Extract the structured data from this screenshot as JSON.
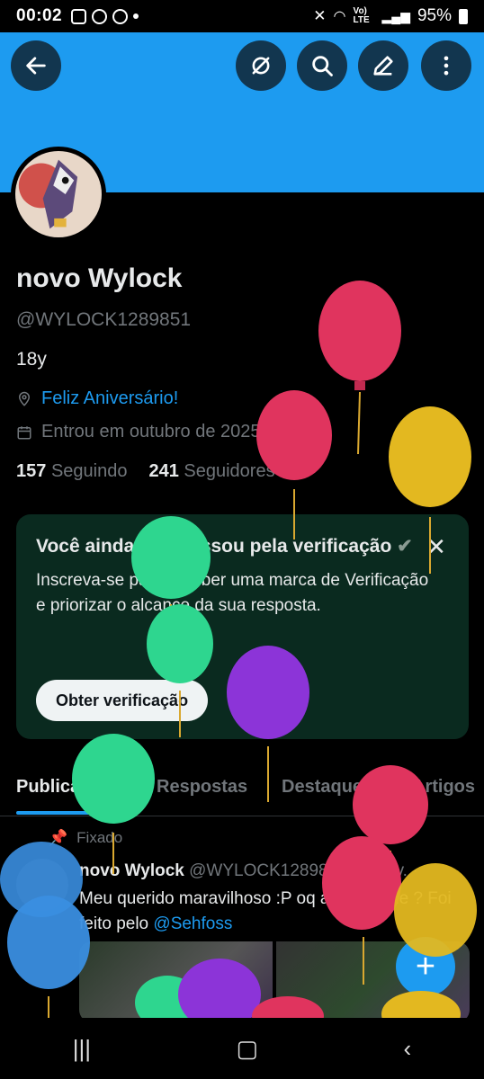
{
  "status_bar": {
    "time": "00:02",
    "network": "Vo) LTE",
    "battery": "95%"
  },
  "profile": {
    "name": "novo Wylock",
    "handle": "@WYLOCK1289851",
    "bio": "18y",
    "birthday_link": "Feliz Aniversário!",
    "joined": "Entrou em outubro de 2025",
    "following_count": "157",
    "following_label": "Seguindo",
    "followers_count": "241",
    "followers_label": "Seguidores"
  },
  "verification_card": {
    "title": "Você ainda não passou pela verificação",
    "body": "Inscreva-se para receber uma marca de Verificação e priorizar o alcance da sua resposta.",
    "button": "Obter verificação"
  },
  "tabs": [
    "Publicações",
    "Respostas",
    "Destaques",
    "Artigos"
  ],
  "post": {
    "pinned_label": "Fixado",
    "author": "novo Wylock",
    "handle_date": "@WYLOCK12898... · 02 fev. ·",
    "text": "Meu querido maravilhoso :P oq acham dele ? Foi feito pelo ",
    "mention": "@Sehfoss"
  },
  "colors": {
    "accent": "#1d9bf0",
    "banner": "#1d9bf0",
    "card": "#0a2a1f"
  },
  "icons": [
    "back-icon",
    "hide-icon",
    "search-icon",
    "edit-icon",
    "more-icon",
    "location-icon",
    "calendar-icon",
    "verified-icon",
    "close-icon",
    "pin-icon",
    "plus-icon"
  ]
}
